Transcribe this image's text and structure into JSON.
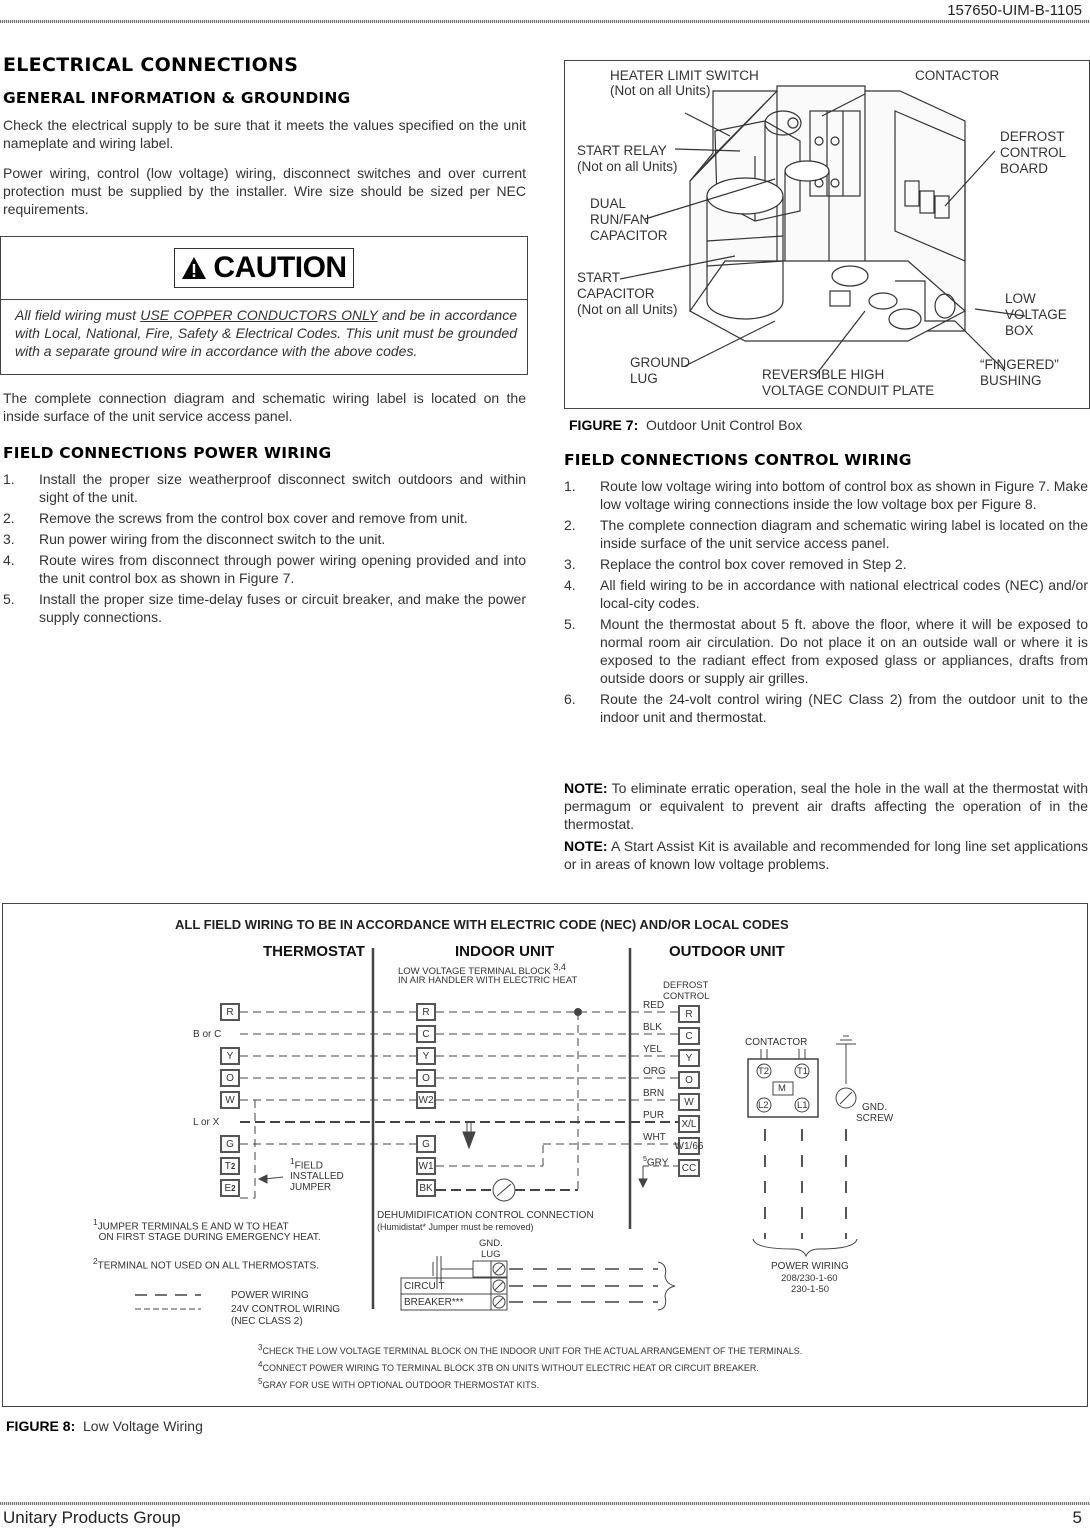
{
  "header": {
    "doc_id": "157650-UIM-B-1105"
  },
  "left": {
    "title": "ELECTRICAL CONNECTIONS",
    "general": {
      "heading": "GENERAL INFORMATION & GROUNDING",
      "p1": "Check the electrical supply to be sure that it meets the values specified on the unit nameplate and wiring label.",
      "p2": "Power wiring, control (low voltage) wiring, disconnect switches and over current protection must be supplied by the installer. Wire size should be sized per NEC requirements."
    },
    "caution": {
      "label": "CAUTION",
      "text_before": "All field wiring must ",
      "text_underlined": "USE COPPER CONDUCTORS ONLY",
      "text_after": " and be in accordance with Local, National, Fire, Safety & Electrical Codes. This unit must be grounded with a separate ground wire in accordance with the above codes."
    },
    "after_caution": "The complete connection diagram and schematic wiring label is located on the inside surface of the unit service access panel.",
    "power": {
      "heading": "FIELD CONNECTIONS POWER WIRING",
      "items": [
        {
          "n": "1.",
          "t": "Install the proper size weatherproof disconnect switch outdoors and within sight of the unit."
        },
        {
          "n": "2.",
          "t": "Remove the screws from the control box cover and remove from unit."
        },
        {
          "n": "3.",
          "t": "Run power wiring from the disconnect switch to the unit."
        },
        {
          "n": "4.",
          "t": "Route wires from disconnect through power wiring opening provided and into the unit control box as shown in Figure 7."
        },
        {
          "n": "5.",
          "t": "Install the proper size time-delay fuses or circuit breaker, and make the power supply connections."
        }
      ]
    }
  },
  "figure7": {
    "labels": {
      "heater_limit": "HEATER LIMIT SWITCH",
      "heater_limit_note": "(Not on all Units)",
      "contactor": "CONTACTOR",
      "start_relay": "START RELAY",
      "start_relay_note": "(Not on all Units)",
      "defrost": "DEFROST",
      "defrost2": "CONTROL",
      "defrost3": "BOARD",
      "dual": "DUAL",
      "dual2": "RUN/FAN",
      "dual3": "CAPACITOR",
      "start_cap": "START",
      "start_cap2": "CAPACITOR",
      "start_cap3": "(Not on all Units)",
      "low_v": "LOW",
      "low_v2": "VOLTAGE",
      "low_v3": "BOX",
      "ground": "GROUND",
      "ground2": "LUG",
      "reversible": "REVERSIBLE HIGH",
      "reversible2": "VOLTAGE CONDUIT PLATE",
      "fingered": "“FINGERED”",
      "fingered2": "BUSHING"
    },
    "caption_label": "FIGURE 7:",
    "caption_text": "Outdoor Unit Control Box"
  },
  "right": {
    "control": {
      "heading": "FIELD CONNECTIONS CONTROL WIRING",
      "items": [
        {
          "n": "1.",
          "t": "Route low voltage wiring into bottom of control box as shown in Figure 7. Make low voltage wiring connections inside the low voltage box per Figure 8."
        },
        {
          "n": "2.",
          "t": "The complete connection diagram and schematic wiring label is located on the inside surface of the unit service access panel."
        },
        {
          "n": "3.",
          "t": "Replace the control box cover removed in Step 2."
        },
        {
          "n": "4.",
          "t": "All field wiring to be in accordance with national electrical codes (NEC) and/or local-city codes."
        },
        {
          "n": "5.",
          "t": "Mount the thermostat about 5 ft. above the floor, where it will be exposed to normal room air circulation. Do not place it on an outside wall or where it is exposed to the radiant effect from exposed glass or appliances, drafts from outside doors or supply air grilles."
        },
        {
          "n": "6.",
          "t": "Route the 24-volt control wiring (NEC Class 2) from the outdoor unit to the indoor unit and thermostat."
        }
      ]
    },
    "notes": [
      {
        "label": "NOTE:",
        "text": " To eliminate erratic operation, seal the hole in the wall at the thermostat with permagum or equivalent to prevent air drafts affecting the operation of in the thermostat."
      },
      {
        "label": "NOTE:",
        "text": " A Start Assist Kit is available and recommended for long line set applications or in areas of known low voltage problems."
      }
    ]
  },
  "figure8": {
    "title": "ALL FIELD WIRING TO BE IN ACCORDANCE WITH ELECTRIC CODE (NEC)  AND/OR LOCAL CODES",
    "thermostat": {
      "heading": "THERMOSTAT",
      "terminals": [
        "R",
        "B or C",
        "Y",
        "O",
        "W",
        "L or X",
        "G",
        "T",
        "E"
      ],
      "sup": "2"
    },
    "indoor": {
      "heading": "INDOOR UNIT",
      "sub1": "LOW VOLTAGE TERMINAL BLOCK",
      "sub1_sup": "3,4",
      "sub2": "IN AIR HANDLER WITH ELECTRIC HEAT",
      "terminals_top": [
        "R",
        "C",
        "Y",
        "O",
        "W2"
      ],
      "terminals_bottom": [
        "G",
        "W1",
        "BK"
      ],
      "dehum1": "DEHUMIDIFICATION CONTROL CONNECTION",
      "dehum2": "(Humidistat* Jumper must be removed)",
      "gnd": "GND.",
      "lug": "LUG",
      "circuit": "CIRCUIT",
      "breaker": "BREAKER***"
    },
    "outdoor": {
      "heading": "OUTDOOR UNIT",
      "defrost1": "DEFROST",
      "defrost2": "CONTROL",
      "wires": [
        "RED",
        "BLK",
        "YEL",
        "ORG",
        "BRN",
        "PUR",
        "WHT",
        "GRY"
      ],
      "gry_sup": "5",
      "terminals": [
        "R",
        "C",
        "Y",
        "O",
        "W",
        "X/L",
        "W1/66",
        "CC"
      ],
      "contactor": "CONTACTOR",
      "contactor_terms": [
        "T2",
        "T1",
        "M",
        "L2",
        "L1"
      ],
      "gnd_screw1": "GND.",
      "gnd_screw2": "SCREW",
      "power1": "POWER WIRING",
      "power2": "208/230-1-60",
      "power3": "230-1-50"
    },
    "jumper": {
      "sup": "1",
      "l1": "FIELD",
      "l2": "INSTALLED",
      "l3": "JUMPER"
    },
    "footnotes_left": [
      {
        "sup": "1",
        "l1": "JUMPER TERMINALS E AND W TO HEAT",
        "l2": "ON FIRST STAGE DURING EMERGENCY HEAT."
      },
      {
        "sup": "2",
        "l1": "TERMINAL NOT USED ON ALL THERMOSTATS."
      }
    ],
    "legend": {
      "power": "POWER WIRING",
      "control": "24V CONTROL WIRING",
      "control2": "(NEC CLASS 2)"
    },
    "footnotes_bottom": [
      {
        "sup": "3",
        "t": "CHECK THE LOW VOLTAGE TERMINAL BLOCK ON THE INDOOR UNIT FOR THE ACTUAL ARRANGEMENT OF THE TERMINALS."
      },
      {
        "sup": "4",
        "t": "CONNECT POWER WIRING TO TERMINAL BLOCK 3TB ON UNITS WITHOUT ELECTRIC HEAT OR CIRCUIT BREAKER."
      },
      {
        "sup": "5",
        "t": "GRAY FOR USE WITH OPTIONAL OUTDOOR THERMOSTAT KITS."
      }
    ],
    "caption_label": "FIGURE 8:",
    "caption_text": "Low Voltage Wiring"
  },
  "footer": {
    "company": "Unitary Products Group",
    "page": "5"
  }
}
